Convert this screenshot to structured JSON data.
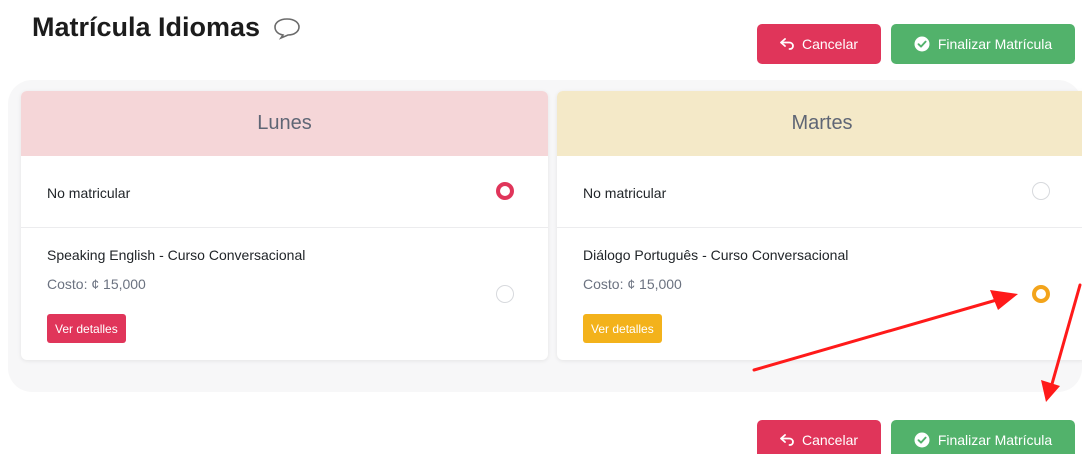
{
  "header": {
    "title": "Matrícula Idiomas",
    "title_icon": "speech-bubble-icon"
  },
  "actions": {
    "cancel_label": "Cancelar",
    "finish_label": "Finalizar Matrícula",
    "cancel_icon": "undo-arrow-icon",
    "finish_icon": "check-circle-icon"
  },
  "days": [
    {
      "name": "Lunes",
      "color": "#f5d6d8",
      "none_label": "No matricular",
      "none_selected": true,
      "course": {
        "name": "Speaking English - Curso Conversacional",
        "cost": "Costo: ¢ 15,000",
        "details_label": "Ver detalles",
        "selected": false
      }
    },
    {
      "name": "Martes",
      "color": "#f4e9c8",
      "none_label": "No matricular",
      "none_selected": false,
      "course": {
        "name": "Diálogo Português - Curso Conversacional",
        "cost": "Costo: ¢ 15,000",
        "details_label": "Ver detalles",
        "selected": true
      }
    }
  ],
  "colors": {
    "danger": "#e0355a",
    "success": "#52b26b",
    "warning": "#f3a41b",
    "annotation_arrow": "#ff1a1a"
  }
}
